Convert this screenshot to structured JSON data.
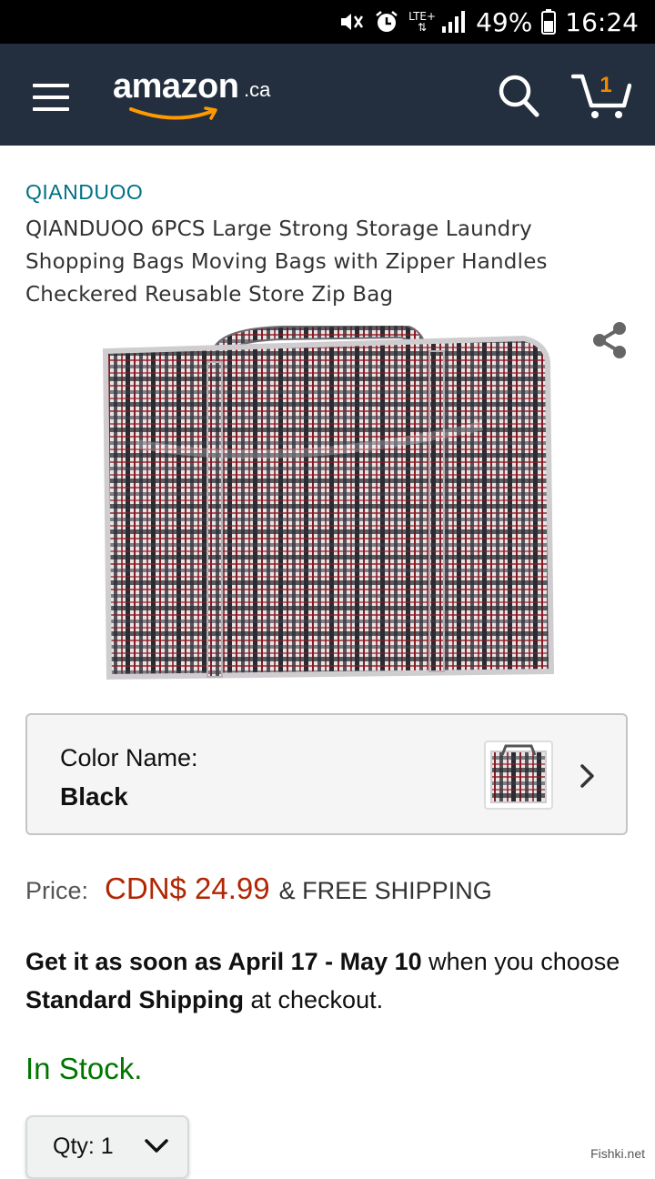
{
  "status_bar": {
    "network": "LTE+",
    "battery": "49%",
    "time": "16:24"
  },
  "header": {
    "logo_text": "amazon",
    "logo_suffix": ".ca",
    "cart_count": "1"
  },
  "product": {
    "brand": "QIANDUOO",
    "title": "QIANDUOO 6PCS Large Strong Storage Laundry Shopping Bags Moving Bags with Zipper Handles Checkered Reusable Store Zip Bag"
  },
  "variation": {
    "label": "Color Name:",
    "value": "Black"
  },
  "price": {
    "label": "Price:",
    "value": "CDN$ 24.99",
    "shipping": "& FREE SHIPPING"
  },
  "delivery": {
    "bold_1": "Get it as soon as April 17 - May 10",
    "text_1": " when you choose ",
    "bold_2": "Standard Shipping",
    "text_2": " at checkout."
  },
  "stock": "In Stock.",
  "quantity": {
    "label": "Qty:",
    "value": "1"
  },
  "watermark": "Fishki.net",
  "colors": {
    "header_bg": "#232f3e",
    "link": "#007185",
    "price": "#b12704",
    "in_stock": "#007600",
    "cart_accent": "#f08804",
    "smile": "#ff9900"
  }
}
